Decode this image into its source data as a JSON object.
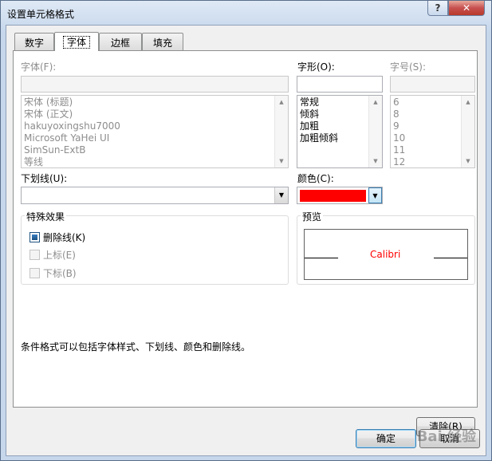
{
  "window": {
    "title": "设置单元格格式",
    "help_label": "?",
    "close_label": "✕"
  },
  "tabs": [
    {
      "label": "数字"
    },
    {
      "label": "字体"
    },
    {
      "label": "边框"
    },
    {
      "label": "填充"
    }
  ],
  "font": {
    "label": "字体(F):",
    "value": "",
    "items": [
      "宋体 (标题)",
      "宋体 (正文)",
      "hakuyoxingshu7000",
      "Microsoft YaHei UI",
      "SimSun-ExtB",
      "等线"
    ]
  },
  "style": {
    "label": "字形(O):",
    "value": "",
    "items": [
      "常规",
      "倾斜",
      "加粗",
      "加粗倾斜"
    ]
  },
  "size": {
    "label": "字号(S):",
    "value": "",
    "items": [
      "6",
      "8",
      "9",
      "10",
      "11",
      "12"
    ]
  },
  "underline": {
    "label": "下划线(U):",
    "value": ""
  },
  "color": {
    "label": "颜色(C):",
    "value": "#ff0000"
  },
  "effects": {
    "title": "特殊效果",
    "strikethrough": {
      "label": "删除线(K)",
      "checked": true
    },
    "superscript": {
      "label": "上标(E)",
      "checked": false
    },
    "subscript": {
      "label": "下标(B)",
      "checked": false
    }
  },
  "preview": {
    "title": "预览",
    "sample": "Calibri",
    "sample_color": "#ff0000"
  },
  "info_text": "条件格式可以包括字体样式、下划线、颜色和删除线。",
  "buttons": {
    "clear": "清除(R)",
    "ok": "确定",
    "cancel": "取消"
  },
  "watermark": "Bai 经验"
}
